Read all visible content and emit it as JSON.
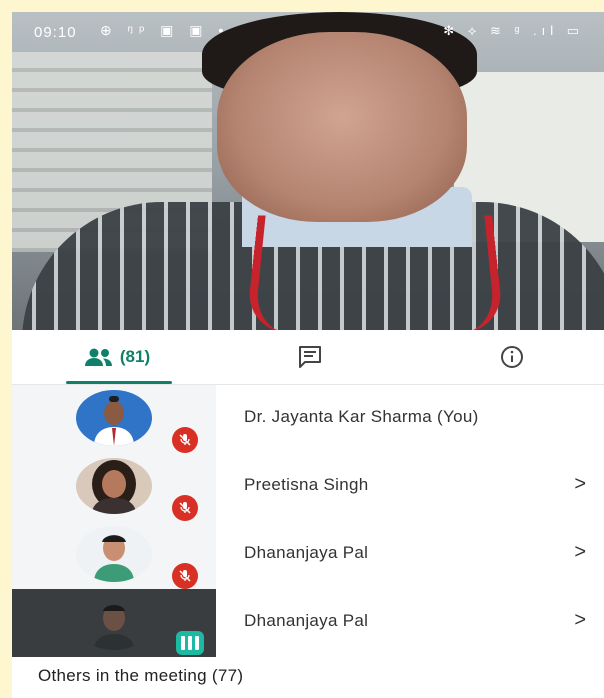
{
  "status_bar": {
    "time": "09:10",
    "left_icons": "⊕ ᵑᵖ ▣ ▣ •",
    "right_icons": "✻ ⟡ ≋ ᵍ .ıl ▭"
  },
  "tabs": {
    "people_count": "(81)",
    "people_icon": "people-icon",
    "chat_icon": "chat-icon",
    "info_icon": "info-icon"
  },
  "participants": [
    {
      "name": "Dr. Jayanta Kar Sharma (You)",
      "muted": true,
      "chevron": ""
    },
    {
      "name": "Preetisna Singh",
      "muted": true,
      "chevron": ">"
    },
    {
      "name": "Dhananjaya Pal",
      "muted": true,
      "chevron": ">"
    },
    {
      "name": "Dhananjaya Pal",
      "muted": false,
      "speaking": true,
      "chevron": ">"
    }
  ],
  "others": {
    "label": "Others in the meeting (77)"
  },
  "colors": {
    "accent": "#11806a",
    "muted_red": "#d93025",
    "speaking": "#1db9a3",
    "frame": "#fdf6cf"
  }
}
